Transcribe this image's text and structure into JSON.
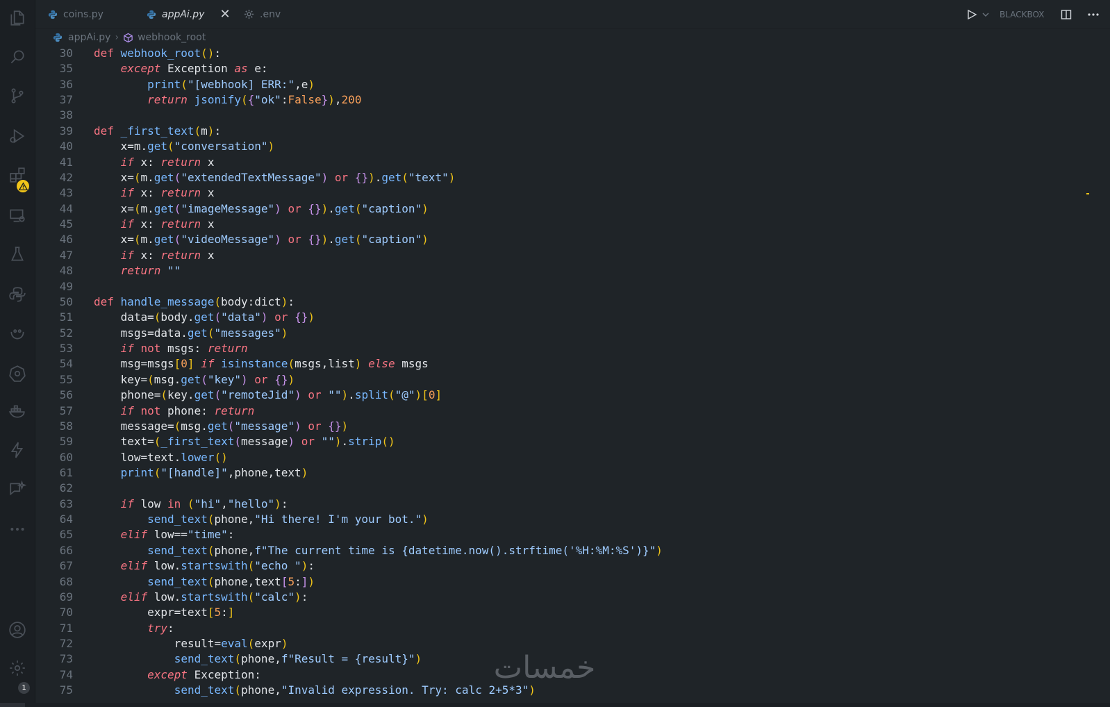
{
  "tabs": [
    {
      "label": "coins.py",
      "icon": "python-icon",
      "active": false
    },
    {
      "label": "appAi.py",
      "icon": "python-icon",
      "active": true
    },
    {
      "label": ".env",
      "icon": "gear-icon",
      "active": false
    }
  ],
  "toolbar": {
    "extension_label": "BLACKBOX"
  },
  "breadcrumb": {
    "file": "appAi.py",
    "symbol": "webhook_root"
  },
  "activity_badges": {
    "notifications": "1"
  },
  "watermark": {
    "text": "خمسات"
  },
  "colors": {
    "background": "#1f2428",
    "keyword": "#f97583",
    "function": "#79b8ff",
    "string": "#9ecbff",
    "number": "#f8a05a",
    "warning": "#f0c419"
  },
  "code_lines": [
    {
      "n": "30",
      "t": "def webhook_root():"
    },
    {
      "n": "35",
      "t": "    except Exception as e:"
    },
    {
      "n": "36",
      "t": "        print(\"[webhook] ERR:\",e)"
    },
    {
      "n": "37",
      "t": "        return jsonify({\"ok\":False}),200"
    },
    {
      "n": "38",
      "t": ""
    },
    {
      "n": "39",
      "t": "def _first_text(m):"
    },
    {
      "n": "40",
      "t": "    x=m.get(\"conversation\")"
    },
    {
      "n": "41",
      "t": "    if x: return x"
    },
    {
      "n": "42",
      "t": "    x=(m.get(\"extendedTextMessage\") or {}).get(\"text\")"
    },
    {
      "n": "43",
      "t": "    if x: return x"
    },
    {
      "n": "44",
      "t": "    x=(m.get(\"imageMessage\") or {}).get(\"caption\")"
    },
    {
      "n": "45",
      "t": "    if x: return x"
    },
    {
      "n": "46",
      "t": "    x=(m.get(\"videoMessage\") or {}).get(\"caption\")"
    },
    {
      "n": "47",
      "t": "    if x: return x"
    },
    {
      "n": "48",
      "t": "    return \"\""
    },
    {
      "n": "49",
      "t": ""
    },
    {
      "n": "50",
      "t": "def handle_message(body:dict):"
    },
    {
      "n": "51",
      "t": "    data=(body.get(\"data\") or {})"
    },
    {
      "n": "52",
      "t": "    msgs=data.get(\"messages\")"
    },
    {
      "n": "53",
      "t": "    if not msgs: return"
    },
    {
      "n": "54",
      "t": "    msg=msgs[0] if isinstance(msgs,list) else msgs"
    },
    {
      "n": "55",
      "t": "    key=(msg.get(\"key\") or {})"
    },
    {
      "n": "56",
      "t": "    phone=(key.get(\"remoteJid\") or \"\").split(\"@\")[0]"
    },
    {
      "n": "57",
      "t": "    if not phone: return"
    },
    {
      "n": "58",
      "t": "    message=(msg.get(\"message\") or {})"
    },
    {
      "n": "59",
      "t": "    text=(_first_text(message) or \"\").strip()"
    },
    {
      "n": "60",
      "t": "    low=text.lower()"
    },
    {
      "n": "61",
      "t": "    print(\"[handle]\",phone,text)"
    },
    {
      "n": "62",
      "t": ""
    },
    {
      "n": "63",
      "t": "    if low in (\"hi\",\"hello\"):"
    },
    {
      "n": "64",
      "t": "        send_text(phone,\"Hi there! I'm your bot.\")"
    },
    {
      "n": "65",
      "t": "    elif low==\"time\":"
    },
    {
      "n": "66",
      "t": "        send_text(phone,f\"The current time is {datetime.now().strftime('%H:%M:%S')}\")"
    },
    {
      "n": "67",
      "t": "    elif low.startswith(\"echo \"):"
    },
    {
      "n": "68",
      "t": "        send_text(phone,text[5:])"
    },
    {
      "n": "69",
      "t": "    elif low.startswith(\"calc\"):"
    },
    {
      "n": "70",
      "t": "        expr=text[5:]"
    },
    {
      "n": "71",
      "t": "        try:"
    },
    {
      "n": "72",
      "t": "            result=eval(expr)"
    },
    {
      "n": "73",
      "t": "            send_text(phone,f\"Result = {result}\")"
    },
    {
      "n": "74",
      "t": "        except Exception:"
    },
    {
      "n": "75",
      "t": "            send_text(phone,\"Invalid expression. Try: calc 2+5*3\")"
    }
  ]
}
